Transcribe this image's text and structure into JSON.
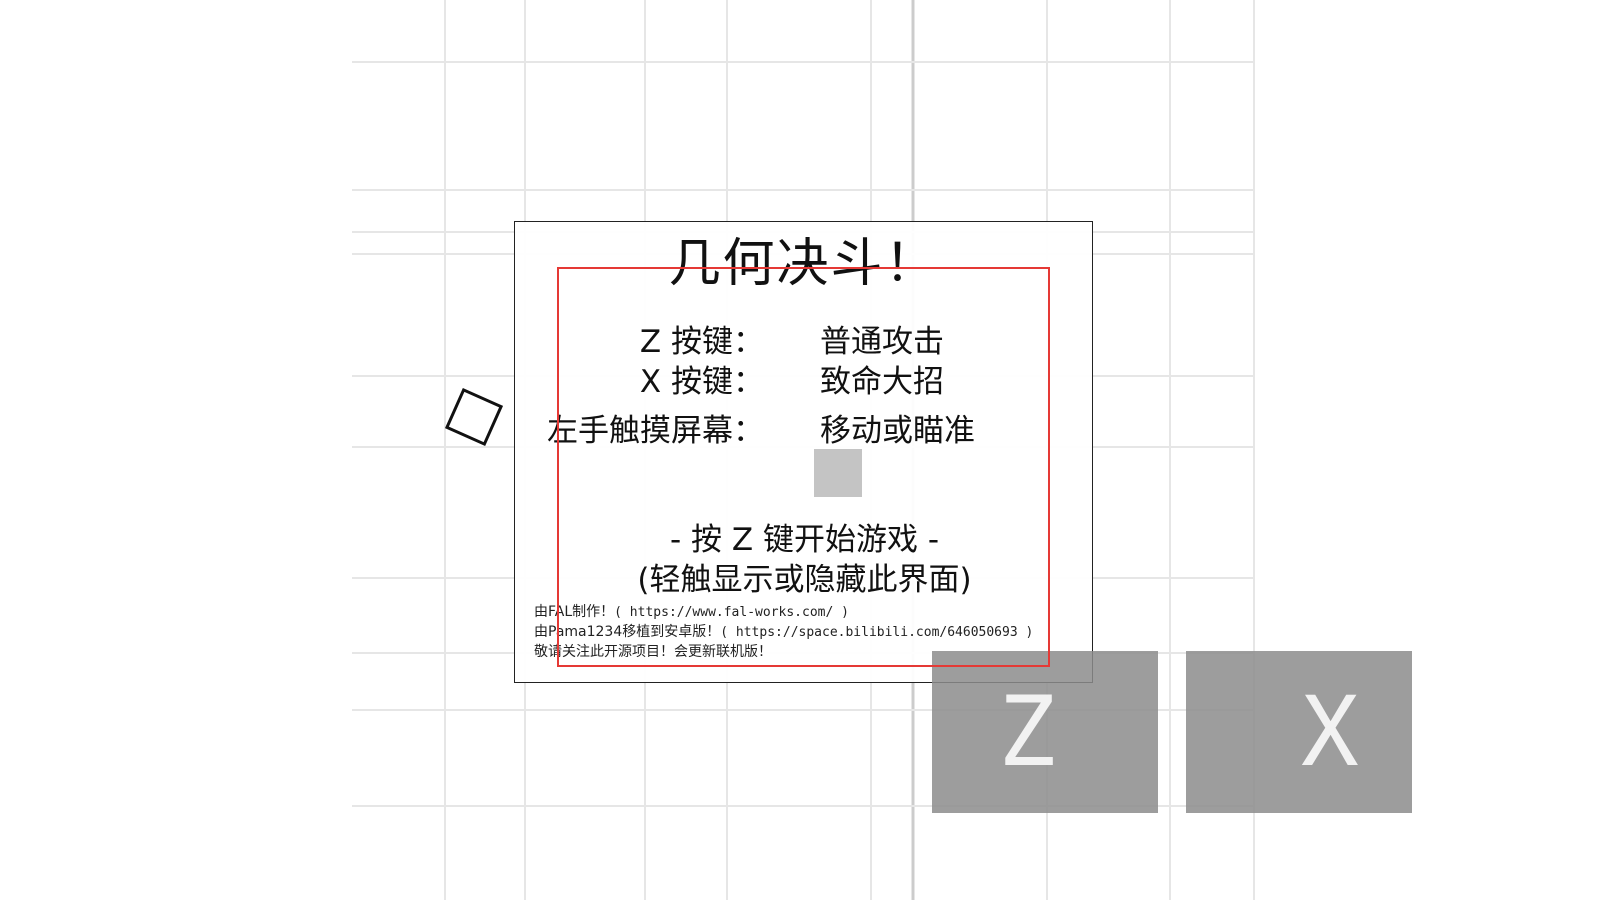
{
  "game": {
    "title": "几何决斗！"
  },
  "controls": [
    {
      "key": "Z 按键：",
      "action": "普通攻击"
    },
    {
      "key": "X 按键：",
      "action": "致命大招"
    },
    {
      "key": "左手触摸屏幕：",
      "action": "移动或瞄准"
    }
  ],
  "start": {
    "prompt": "- 按 Z 键开始游戏 -",
    "hint": "(轻触显示或隐藏此界面)"
  },
  "credits": {
    "line1_text": "由FAL制作！",
    "line1_url": "( https://www.fal-works.com/ )",
    "line2_text": "由Pama1234移植到安卓版！",
    "line2_url": "( https://space.bilibili.com/646050693 )",
    "line3_text": "敬请关注此开源项目！会更新联机版！"
  },
  "buttons": {
    "z_label": "Z",
    "x_label": "X"
  },
  "colors": {
    "grid_line": "#e6e6e6",
    "grid_axis": "#cccccc",
    "button_fill": "#8c8c8c",
    "overlay_frame": "#e53935",
    "icon_square": "#c4c4c4"
  }
}
